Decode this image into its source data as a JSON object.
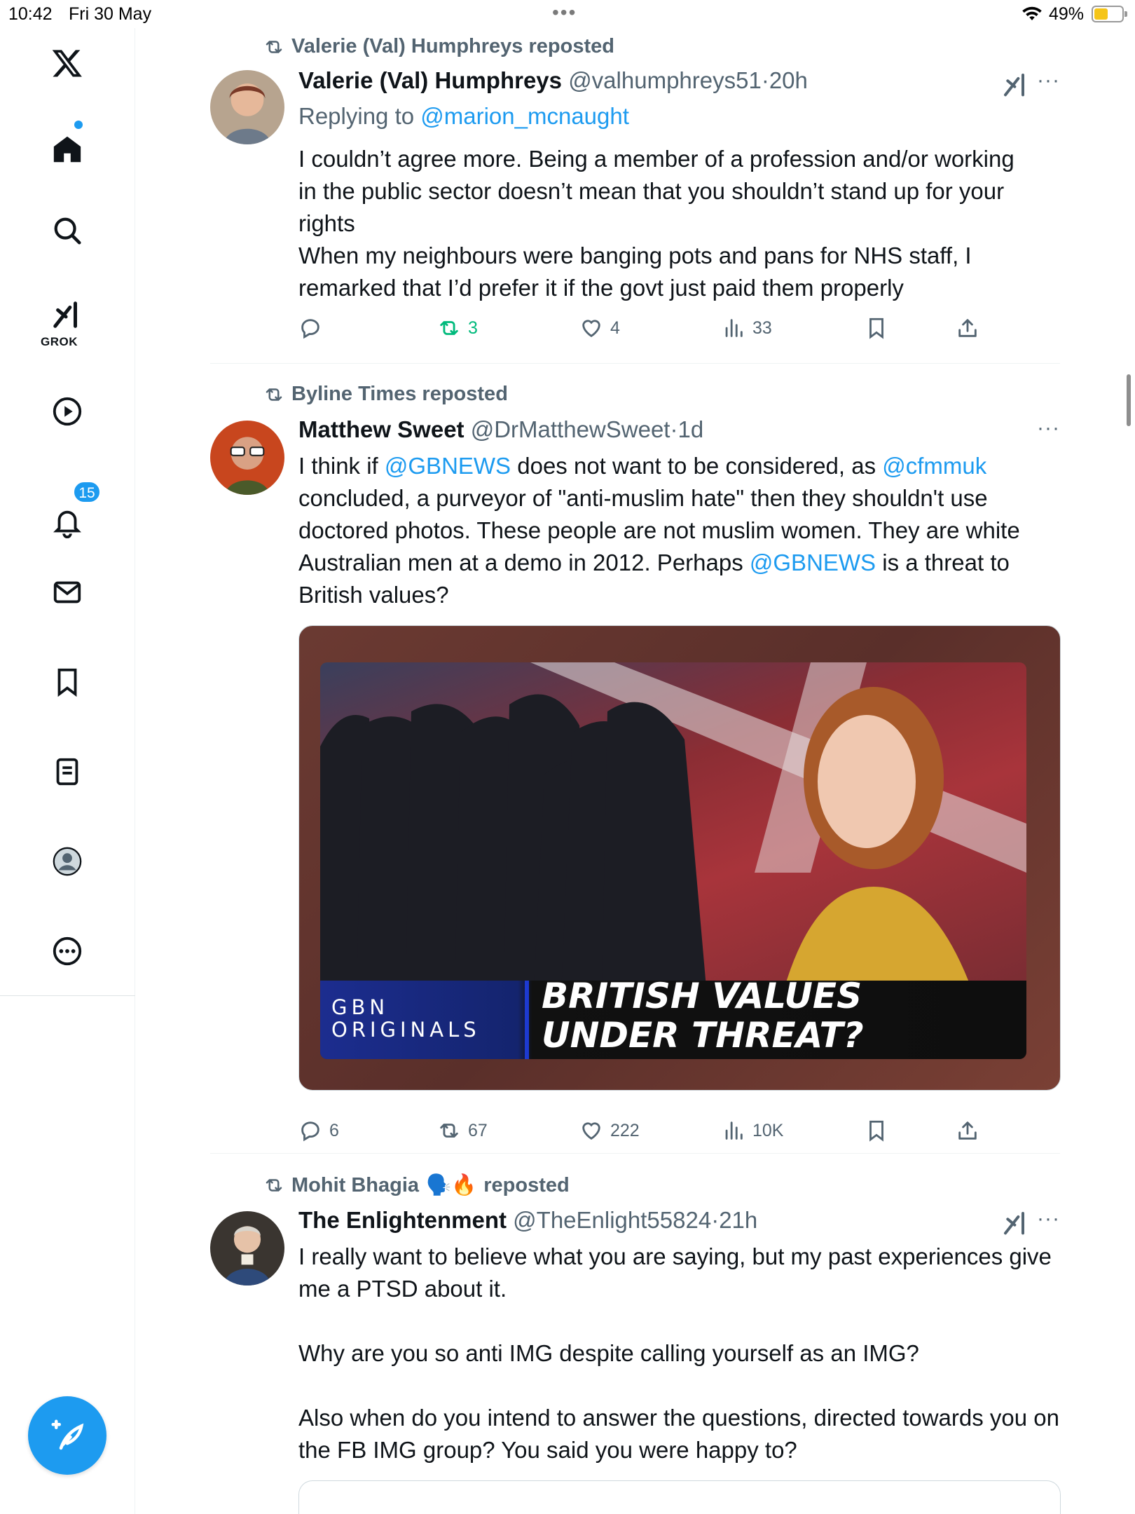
{
  "status_bar": {
    "time": "10:42",
    "date": "Fri 30 May",
    "battery_pct": "49%",
    "battery_level": 0.49
  },
  "sidebar": {
    "grok_label": "GROK",
    "notifications_badge": "15"
  },
  "posts": [
    {
      "reposted_by": "Valerie (Val) Humphreys reposted",
      "name": "Valerie (Val) Humphreys",
      "handle": "@valhumphreys51",
      "time": "20h",
      "replying_prefix": "Replying to ",
      "replying_handle": "@marion_mcnaught",
      "text_lines": [
        "I couldn’t agree more. Being a member of a profession and/or working",
        "in the public sector doesn’t mean that you shouldn’t stand up for your",
        "rights",
        "When my neighbours were banging pots and pans for NHS staff, I",
        "remarked that I’d prefer it if the govt just paid them properly"
      ],
      "replies": "",
      "reposts": "3",
      "likes": "4",
      "views": "33"
    },
    {
      "reposted_by": "Byline Times reposted",
      "name": "Matthew Sweet",
      "handle": "@DrMatthewSweet",
      "time": "1d",
      "text": {
        "p1": "I think if ",
        "m1": "@GBNEWS",
        "p2": " does not want to be considered, as ",
        "m2": "@cfmmuk",
        "p3": " concluded, a purveyor of \"anti-muslim hate\" then they shouldn't use doctored photos. These people are not muslim women. They are white Australian men at a demo in 2012. Perhaps ",
        "m3": "@GBNEWS",
        "p4": " is a threat to British values?"
      },
      "media": {
        "logo_line1": "GBN",
        "logo_line2": "ORIGINALS",
        "headline_line1": "BRITISH VALUES",
        "headline_line2": "UNDER THREAT?"
      },
      "replies": "6",
      "reposts": "67",
      "likes": "222",
      "views": "10K"
    },
    {
      "reposted_by": "Mohit Bhagia",
      "reposted_suffix": "reposted",
      "reposted_emoji": "🗣️🔥",
      "name": "The Enlightenment",
      "handle": "@TheEnlight55824",
      "time": "21h",
      "text_paragraphs": [
        "I really want to believe what you are saying, but my past experiences give me a PTSD about it.",
        "Why are you so anti IMG despite calling yourself as an IMG?",
        "Also when do you intend to answer the questions, directed towards you on the FB IMG group? You said you were happy to?"
      ]
    }
  ],
  "colors": {
    "accent": "#1d9bf0",
    "repost_active": "#00ba7c",
    "secondary_text": "#536471"
  }
}
